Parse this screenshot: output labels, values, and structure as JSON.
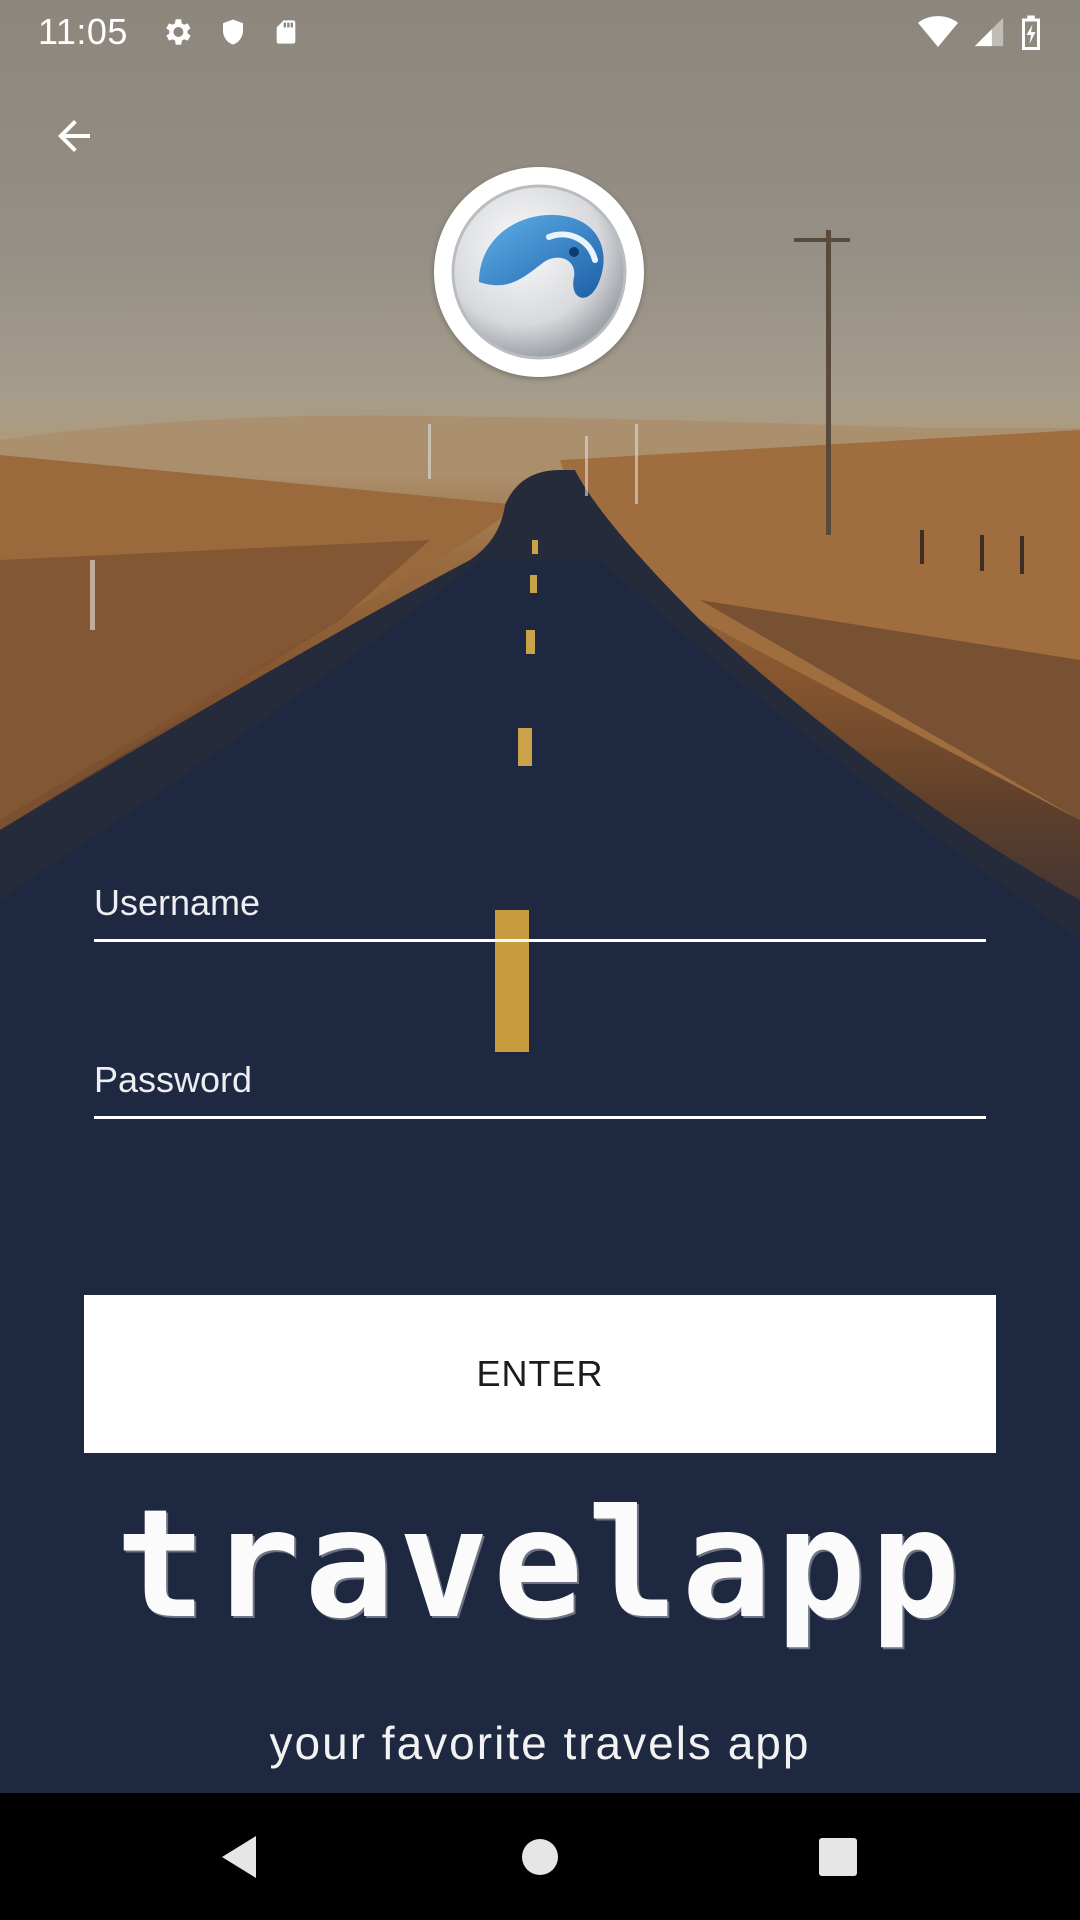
{
  "status_bar": {
    "time": "11:05",
    "left_icons": [
      "settings-icon",
      "shield-icon",
      "sd-card-icon"
    ],
    "right_icons": [
      "wifi-icon",
      "cellular-signal-icon",
      "battery-charging-icon"
    ]
  },
  "header": {
    "back_icon": "arrow-back-icon"
  },
  "logo": {
    "icon": "app-logo-icon",
    "accent_color": "#2e7fc8"
  },
  "form": {
    "username": {
      "placeholder": "Username",
      "value": ""
    },
    "password": {
      "placeholder": "Password",
      "value": ""
    },
    "enter_label": "ENTER"
  },
  "brand": {
    "name": "travelapp",
    "tagline": "your favorite travels app"
  },
  "nav_bar": {
    "buttons": [
      "nav-back-icon",
      "nav-home-icon",
      "nav-recents-icon"
    ]
  },
  "colors": {
    "button_bg": "#ffffff",
    "button_text": "#1c1c1c",
    "field_line": "#ffffff",
    "nav_bg": "#000000"
  }
}
